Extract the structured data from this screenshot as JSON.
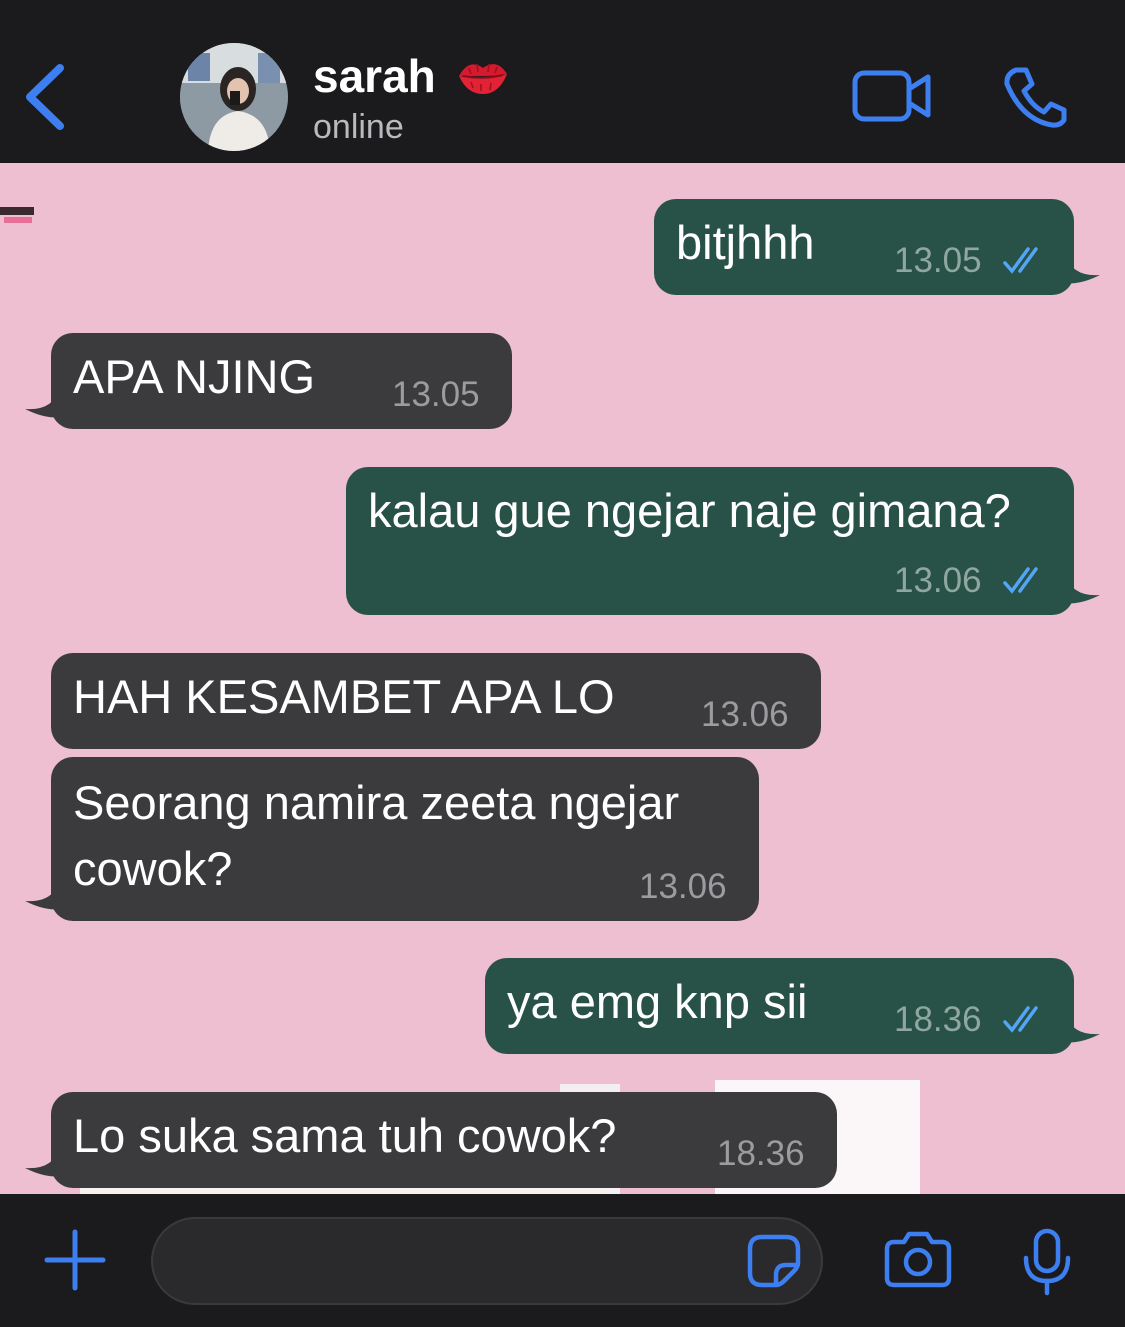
{
  "header": {
    "back_icon": "chevron-left-icon",
    "contact_name": "sarah",
    "name_emoji": "kiss-mark-icon",
    "status": "online",
    "video_icon": "video-camera-icon",
    "call_icon": "phone-icon"
  },
  "messages": [
    {
      "direction": "out",
      "text": "bitjhhh",
      "time": "13.05",
      "read": true
    },
    {
      "direction": "in",
      "text": "APA NJING",
      "time": "13.05"
    },
    {
      "direction": "out",
      "text": "kalau gue ngejar naje gimana?",
      "time": "13.06",
      "read": true
    },
    {
      "direction": "in",
      "text": "HAH KESAMBET APA LO",
      "time": "13.06"
    },
    {
      "direction": "in",
      "text": "Seorang namira zeeta ngejar",
      "text2": "cowok?",
      "time": "13.06"
    },
    {
      "direction": "out",
      "text": "ya emg knp sii",
      "time": "18.36",
      "read": true
    },
    {
      "direction": "in",
      "text": "Lo suka sama tuh cowok?",
      "time": "18.36"
    }
  ],
  "input": {
    "value": "",
    "plus_icon": "plus-icon",
    "sticker_icon": "sticker-icon",
    "camera_icon": "camera-icon",
    "mic_icon": "microphone-icon"
  },
  "colors": {
    "accent": "#3d7ff0",
    "outgoing_bubble": "#285247",
    "incoming_bubble": "#3b3b3d",
    "wallpaper": "#eebfd0",
    "read_tick": "#53a6f5"
  }
}
